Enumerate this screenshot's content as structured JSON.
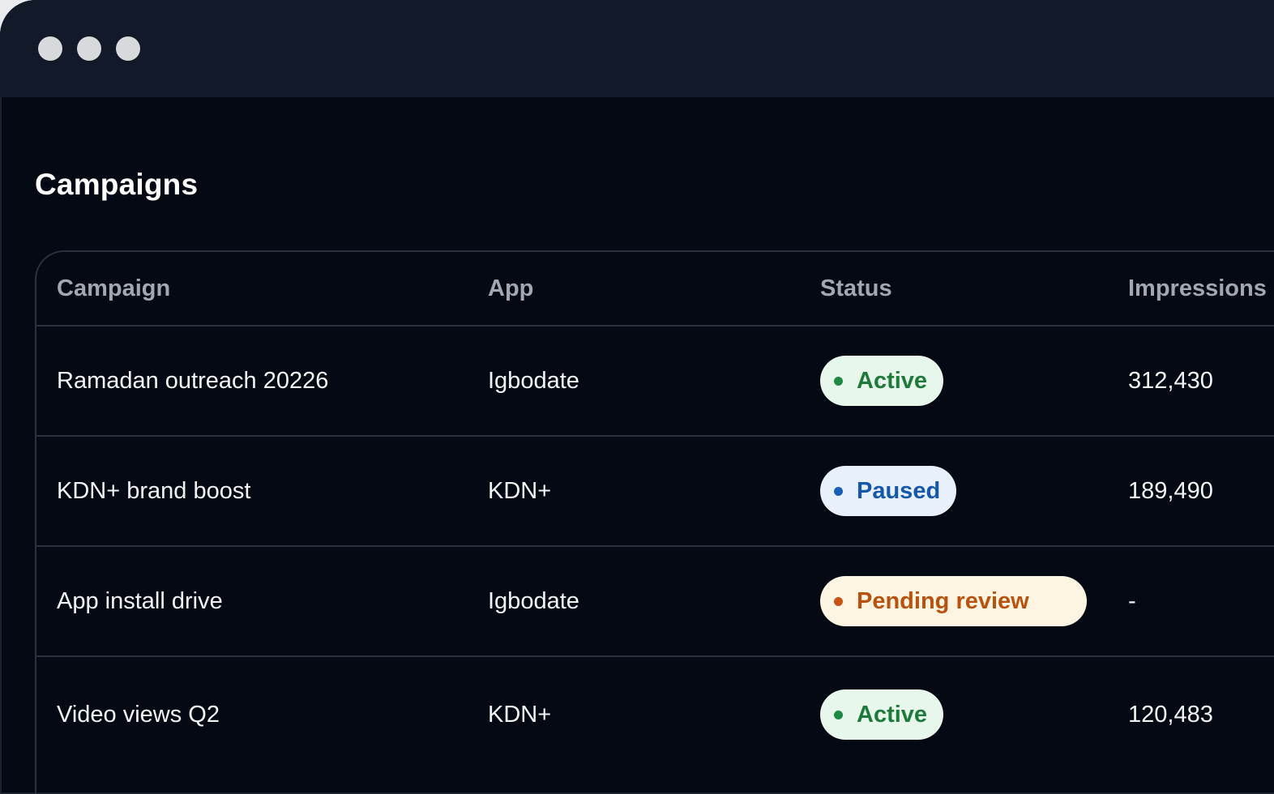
{
  "window": {
    "controls": [
      "close",
      "minimize",
      "maximize"
    ]
  },
  "page": {
    "title": "Campaigns"
  },
  "table": {
    "columns": [
      "Campaign",
      "App",
      "Status",
      "Impressions"
    ],
    "rows": [
      {
        "campaign": "Ramadan outreach 20226",
        "app": "Igbodate",
        "status": "Active",
        "status_kind": "active",
        "impressions": "312,430"
      },
      {
        "campaign": "KDN+ brand boost",
        "app": "KDN+",
        "status": "Paused",
        "status_kind": "paused",
        "impressions": "189,490"
      },
      {
        "campaign": "App install drive",
        "app": "Igbodate",
        "status": "Pending review",
        "status_kind": "pending",
        "impressions": "-"
      },
      {
        "campaign": "Video views Q2",
        "app": "KDN+",
        "status": "Active",
        "status_kind": "active",
        "impressions": "120,483"
      }
    ]
  },
  "colors": {
    "background": "#050913",
    "titlebar": "#121a2a",
    "active_bg": "#e8f7ec",
    "active_text": "#1e7a3a",
    "paused_bg": "#e8f0fb",
    "paused_text": "#1558a8",
    "pending_bg": "#fdf5e2",
    "pending_text": "#b8520f"
  }
}
